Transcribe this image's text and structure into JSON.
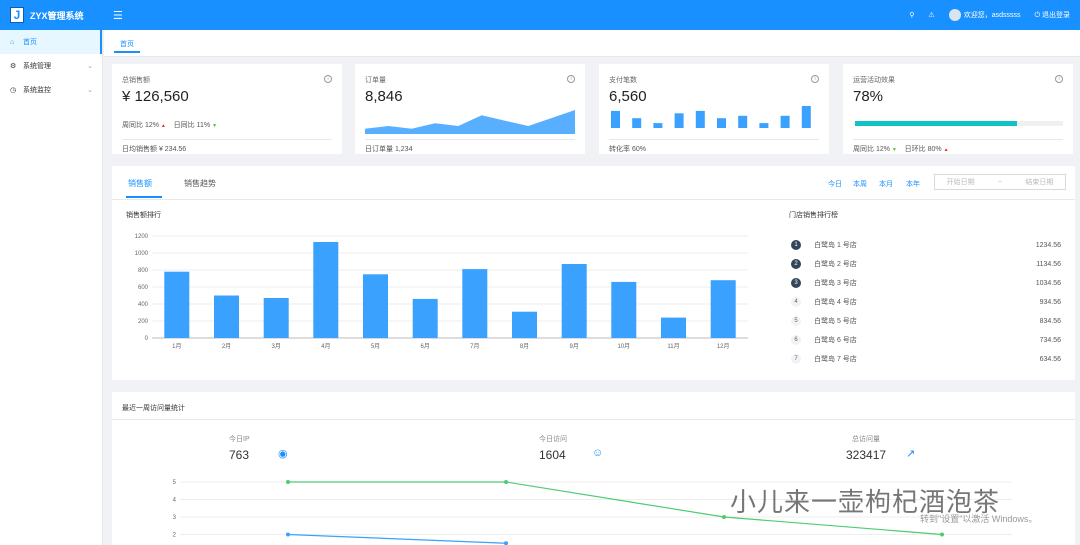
{
  "header": {
    "logo_letter": "J",
    "app_name": "ZYX管理系统",
    "greeting": "欢迎您，asdsssss",
    "logout": "退出登录"
  },
  "sidebar": {
    "items": [
      {
        "label": "首页"
      },
      {
        "label": "系统管理"
      },
      {
        "label": "系统监控"
      }
    ]
  },
  "page_tab": "首页",
  "stats": {
    "sales": {
      "label": "总销售额",
      "value": "¥ 126,560",
      "wow_label": "周同比",
      "wow": "12%",
      "dod_label": "日同比",
      "dod": "11%",
      "footer": "日均销售额 ¥ 234.56"
    },
    "orders": {
      "label": "订单量",
      "value": "8,846",
      "footer": "日订单量 1,234"
    },
    "payments": {
      "label": "支付笔数",
      "value": "6,560",
      "footer": "转化率 60%"
    },
    "ops": {
      "label": "运营活动效果",
      "value": "78%",
      "progress": 0.78,
      "wow_label": "周同比",
      "wow": "12%",
      "dod_label": "日环比",
      "dod": "80%"
    }
  },
  "sales_panel": {
    "tabs": [
      "销售额",
      "销售趋势"
    ],
    "periods": [
      "今日",
      "本周",
      "本月",
      "本年"
    ],
    "start_placeholder": "开始日期",
    "range_sep": "~",
    "end_placeholder": "结束日期",
    "chart_title": "销售额排行",
    "ranking_title": "门店销售排行榜",
    "ranking": [
      {
        "rank": "1",
        "name": "白鹭岛 1 号店",
        "value": "1234.56"
      },
      {
        "rank": "2",
        "name": "白鹭岛 2 号店",
        "value": "1134.56"
      },
      {
        "rank": "3",
        "name": "白鹭岛 3 号店",
        "value": "1034.56"
      },
      {
        "rank": "4",
        "name": "白鹭岛 4 号店",
        "value": "934.56"
      },
      {
        "rank": "5",
        "name": "白鹭岛 5 号店",
        "value": "834.56"
      },
      {
        "rank": "6",
        "name": "白鹭岛 6 号店",
        "value": "734.56"
      },
      {
        "rank": "7",
        "name": "白鹭岛 7 号店",
        "value": "634.56"
      }
    ]
  },
  "chart_data": [
    {
      "type": "bar",
      "title": "销售额排行",
      "categories": [
        "1月",
        "2月",
        "3月",
        "4月",
        "5月",
        "6月",
        "7月",
        "8月",
        "9月",
        "10月",
        "11月",
        "12月"
      ],
      "values": [
        780,
        500,
        470,
        1130,
        750,
        460,
        810,
        310,
        870,
        660,
        240,
        680
      ],
      "yticks": [
        "0",
        "200",
        "400",
        "600",
        "800",
        "1000",
        "1200"
      ],
      "ylim": [
        0,
        1200
      ],
      "grid": true,
      "color": "#3ba1ff"
    },
    {
      "type": "line",
      "yticks": [
        "2",
        "3",
        "4",
        "5"
      ],
      "series": [
        {
          "values": [
            5,
            5,
            3,
            2
          ],
          "color": "#4ecb73"
        },
        {
          "values": [
            2,
            1.5
          ],
          "color": "#3ba1ff"
        }
      ]
    }
  ],
  "orders_area": [
    2,
    3,
    2,
    4,
    3,
    7,
    5,
    3,
    6,
    9
  ],
  "payments_bars": [
    7,
    4,
    2,
    6,
    7,
    4,
    5,
    2,
    5,
    9
  ],
  "visits": {
    "title": "最近一周访问量统计",
    "items": [
      {
        "label": "今日IP",
        "value": "763"
      },
      {
        "label": "今日访问",
        "value": "1604"
      },
      {
        "label": "总访问量",
        "value": "323417"
      }
    ]
  },
  "watermark": "小儿来一壶枸杞酒泡茶",
  "activation_text": "转到\"设置\"以激活 Windows。",
  "colors": {
    "primary": "#1890ff",
    "bar": "#3ba1ff",
    "line_green": "#4ecb73",
    "progress": "#13c2c2"
  }
}
